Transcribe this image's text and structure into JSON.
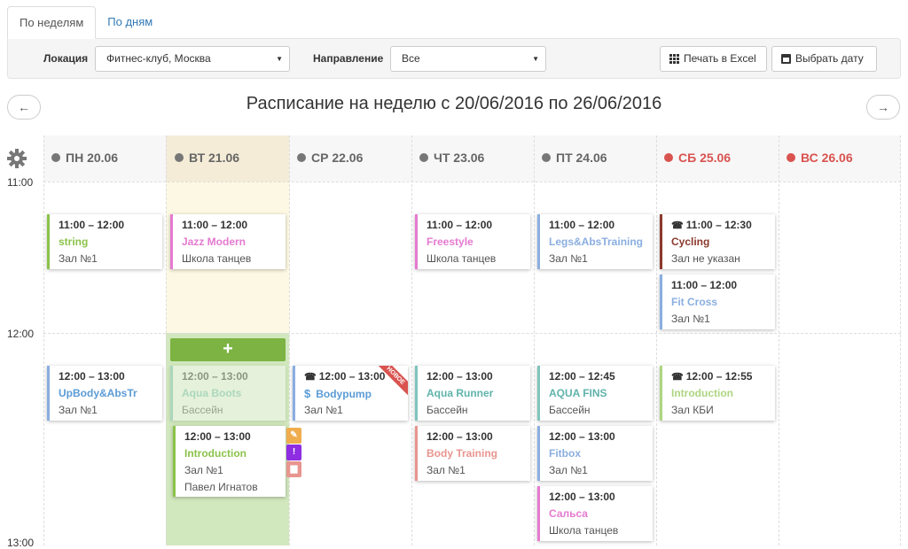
{
  "tabs": [
    "По неделям",
    "По дням"
  ],
  "filters": {
    "location_label": "Локация",
    "location_value": "Фитнес-клуб, Москва",
    "direction_label": "Направление",
    "direction_value": "Все",
    "excel_button": "Печать в Excel",
    "date_button": "Выбрать дату"
  },
  "title": "Расписание на неделю с 20/06/2016 по 26/06/2016",
  "nav": {
    "prev": "←",
    "next": "→"
  },
  "days": [
    {
      "label": "ПН 20.06",
      "weekend": false
    },
    {
      "label": "ВТ 21.06",
      "weekend": false
    },
    {
      "label": "СР 22.06",
      "weekend": false
    },
    {
      "label": "ЧТ 23.06",
      "weekend": false
    },
    {
      "label": "ПТ 24.06",
      "weekend": false
    },
    {
      "label": "СБ 25.06",
      "weekend": true
    },
    {
      "label": "ВС 26.06",
      "weekend": true
    }
  ],
  "times": [
    "11:00",
    "12:00",
    "13:00"
  ],
  "add_label": "+",
  "ribbon_label": "НОВОЕ",
  "colors": {
    "green": "#8bc34a",
    "pink": "#e57ad0",
    "blue": "#8aaee0",
    "teal": "#7fc4bd",
    "salmon": "#e8958f",
    "brown": "#8b3a2e",
    "highlight_col": "#fcf8e3",
    "highlight_head": "#f4ecd7",
    "selected_slot": "#d1e7bd"
  },
  "events": [
    {
      "time": "11:00 – 12:00",
      "name": "string",
      "room": "Зал №1"
    },
    {
      "time": "12:00 – 13:00",
      "name": "UpBody&AbsTr",
      "room": "Зал №1"
    },
    {
      "time": "11:00 – 12:00",
      "name": "Jazz Modern",
      "room": "Школа танцев"
    },
    {
      "time": "12:00 – 13:00",
      "name": "Aqua Boots",
      "room": "Бассейн"
    },
    {
      "time": "12:00 – 13:00",
      "name": "Introduction",
      "room": "Зал №1",
      "trainer": "Павел Игнатов"
    },
    {
      "time": "12:00 – 13:00",
      "name": "Bodypump",
      "room": "Зал №1"
    },
    {
      "time": "11:00 – 12:00",
      "name": "Freestyle",
      "room": "Школа танцев"
    },
    {
      "time": "12:00 – 13:00",
      "name": "Aqua Runner",
      "room": "Бассейн"
    },
    {
      "time": "12:00 – 13:00",
      "name": "Body Training",
      "room": "Зал №1"
    },
    {
      "time": "11:00 – 12:00",
      "name": "Legs&AbsTraining",
      "room": "Зал №1"
    },
    {
      "time": "12:00 – 12:45",
      "name": "AQUA FINS",
      "room": "Бассейн"
    },
    {
      "time": "12:00 – 13:00",
      "name": "Fitbox",
      "room": "Зал №1"
    },
    {
      "time": "12:00 – 13:00",
      "name": "Сальса",
      "room": "Школа танцев"
    },
    {
      "time": "11:00 – 12:30",
      "name": "Cycling",
      "room": "Зал не указан"
    },
    {
      "time": "11:00 – 12:00",
      "name": "Fit Cross",
      "room": "Зал №1"
    },
    {
      "time": "12:00 – 12:55",
      "name": "Introduction",
      "room": "Зал КБИ"
    }
  ]
}
